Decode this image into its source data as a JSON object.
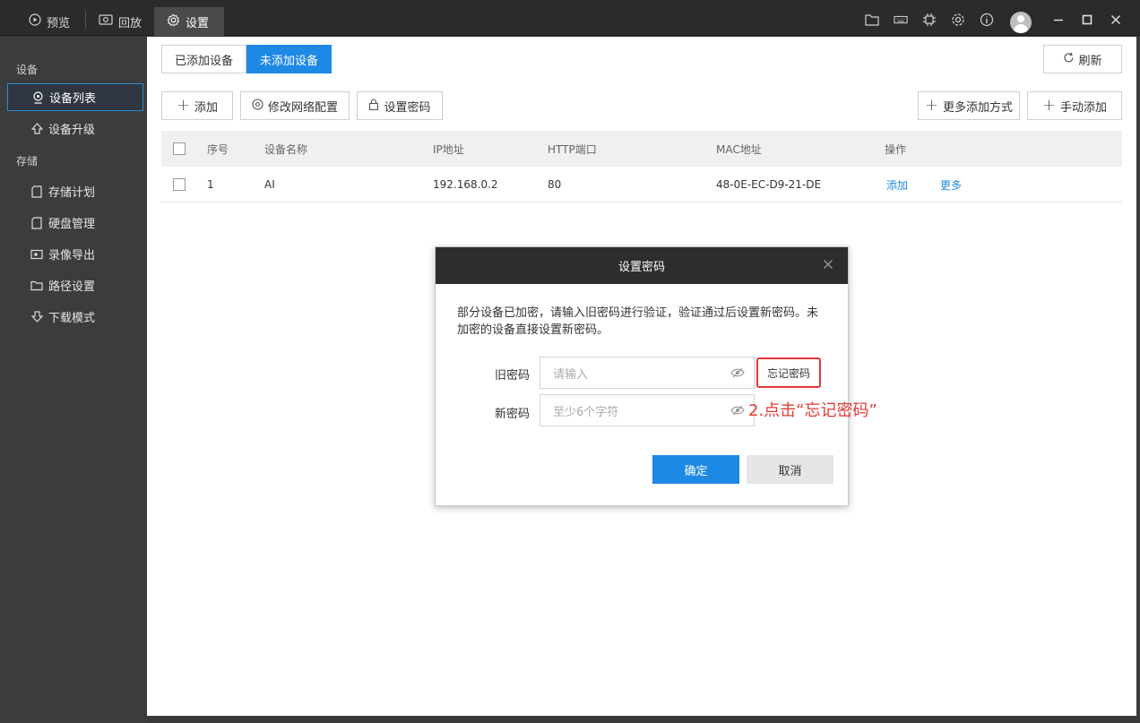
{
  "topbar": {
    "tabs": [
      {
        "label": "预览",
        "icon": "play-circle-icon"
      },
      {
        "label": "回放",
        "icon": "camera-playback-icon"
      },
      {
        "label": "设置",
        "icon": "gear-icon"
      }
    ],
    "right_icons": [
      "folder-icon",
      "keyboard-icon",
      "chip-icon",
      "gear-icon",
      "info-icon",
      "avatar",
      "minimize-icon",
      "maximize-icon",
      "close-icon"
    ]
  },
  "sidebar": {
    "groups": [
      {
        "title": "设备",
        "items": [
          {
            "label": "设备列表",
            "icon": "location-pin-icon",
            "active": true
          },
          {
            "label": "设备升级",
            "icon": "upgrade-arrow-icon"
          }
        ]
      },
      {
        "title": "存储",
        "items": [
          {
            "label": "存储计划",
            "icon": "sd-card-icon"
          },
          {
            "label": "硬盘管理",
            "icon": "disk-icon"
          },
          {
            "label": "录像导出",
            "icon": "camera-export-icon"
          },
          {
            "label": "路径设置",
            "icon": "folder-icon"
          },
          {
            "label": "下载模式",
            "icon": "download-icon"
          }
        ]
      }
    ]
  },
  "main": {
    "subtabs": [
      {
        "label": "已添加设备",
        "active": false
      },
      {
        "label": "未添加设备",
        "active": true
      }
    ],
    "refresh_label": "刷新",
    "toolbar": {
      "add_label": "添加",
      "modify_network_label": "修改网络配置",
      "set_password_label": "设置密码",
      "more_add_label": "更多添加方式",
      "manual_add_label": "手动添加"
    },
    "table": {
      "headers": [
        "序号",
        "设备名称",
        "IP地址",
        "HTTP端口",
        "MAC地址",
        "操作"
      ],
      "rows": [
        {
          "index": "1",
          "name": "AI",
          "ip": "192.168.0.2",
          "port": "80",
          "mac": "48-0E-EC-D9-21-DE",
          "action_add": "添加",
          "action_more": "更多"
        }
      ]
    }
  },
  "dialog": {
    "title": "设置密码",
    "message": "部分设备已加密，请输入旧密码进行验证，验证通过后设置新密码。未加密的设备直接设置新密码。",
    "old_password_label": "旧密码",
    "old_password_placeholder": "请输入",
    "new_password_label": "新密码",
    "new_password_placeholder": "至少6个字符",
    "forgot_label": "忘记密码",
    "ok_label": "确定",
    "cancel_label": "取消"
  },
  "annotation": "2.点击“忘记密码”",
  "colors": {
    "accent": "#1e88e5",
    "highlight": "#e53935",
    "topbar": "#2b2b2b",
    "sidebar": "#3c3c3c"
  }
}
